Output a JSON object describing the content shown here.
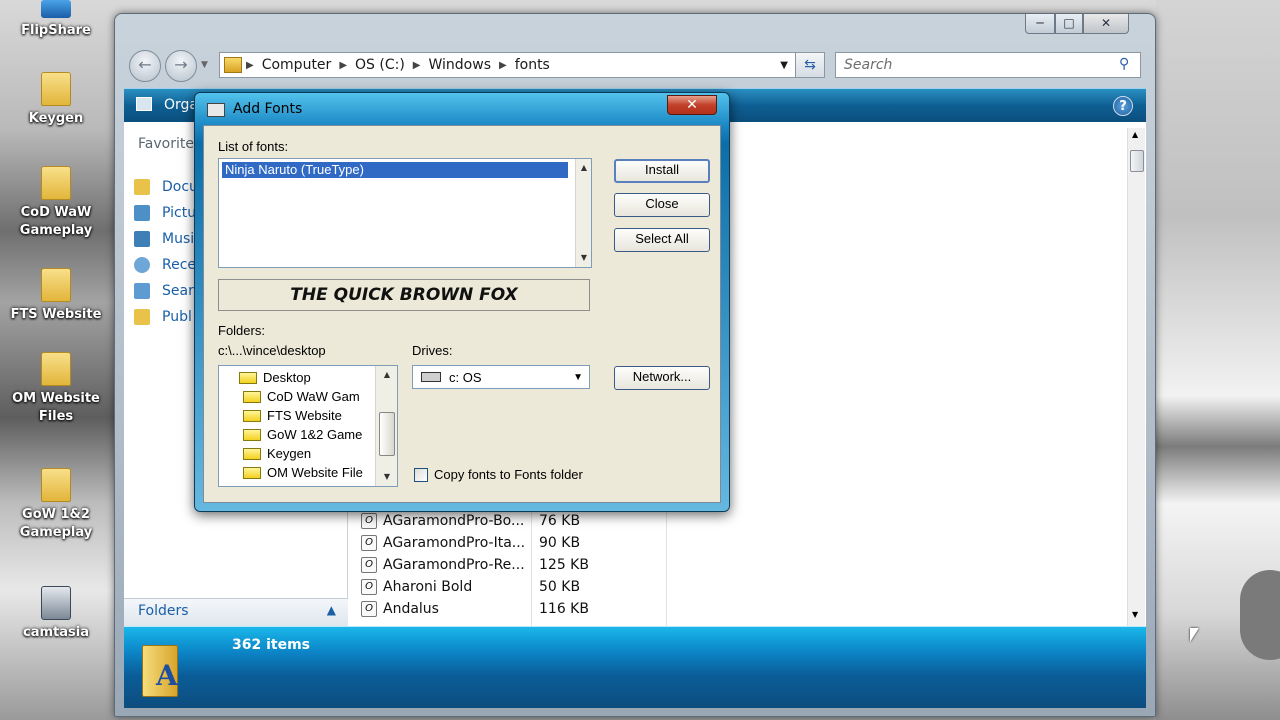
{
  "desktop": {
    "icons": [
      {
        "name": "FlipShare",
        "kind": "app"
      },
      {
        "name": "Keygen",
        "kind": "folder"
      },
      {
        "name": "CoD WaW Gameplay",
        "kind": "folder"
      },
      {
        "name": "FTS Website",
        "kind": "folder"
      },
      {
        "name": "OM Website Files",
        "kind": "folder"
      },
      {
        "name": "GoW 1&2 Gameplay",
        "kind": "folder"
      },
      {
        "name": "camtasia",
        "kind": "app"
      }
    ]
  },
  "explorer": {
    "address": [
      "Computer",
      "OS (C:)",
      "Windows",
      "fonts"
    ],
    "search_placeholder": "Search",
    "toolbar_label": "Orga",
    "favorites_label": "Favorite",
    "nav_items": [
      "Docu",
      "Pictu",
      "Musi",
      "Rece",
      "Searc",
      "Publ"
    ],
    "folders_label": "Folders",
    "files": [
      {
        "name": "AGaramondPro-Bo...",
        "size": "76 KB"
      },
      {
        "name": "AGaramondPro-Ita...",
        "size": "90 KB"
      },
      {
        "name": "AGaramondPro-Re...",
        "size": "125 KB"
      },
      {
        "name": "Aharoni Bold",
        "size": "50 KB"
      },
      {
        "name": "Andalus",
        "size": "116 KB"
      }
    ],
    "item_count": "362 items",
    "colors": {
      "toolbar": "#0f5f93",
      "details": "#0c86c8",
      "link": "#1a5fa8"
    }
  },
  "dialog": {
    "title": "Add Fonts",
    "list_label": "List of fonts:",
    "fonts": [
      "Ninja Naruto (TrueType)"
    ],
    "preview_text": "THE QUICK BROWN FOX",
    "folders_label": "Folders:",
    "folder_path": "c:\\...\\vince\\desktop",
    "tree": [
      "Desktop",
      "CoD WaW Gam",
      "FTS Website",
      "GoW 1&2 Game",
      "Keygen",
      "OM Website File"
    ],
    "drives_label": "Drives:",
    "drive_value": "c: OS",
    "buttons": {
      "install": "Install",
      "close": "Close",
      "select_all": "Select All",
      "network": "Network..."
    },
    "copy_label": "Copy fonts to Fonts folder",
    "copy_checked": false
  }
}
